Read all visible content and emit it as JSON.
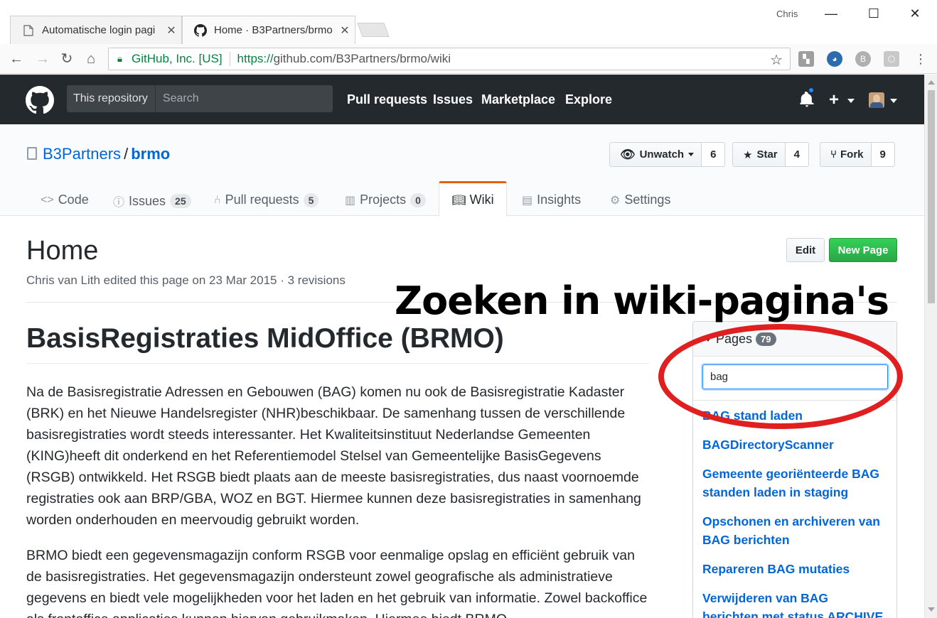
{
  "browser": {
    "user_label": "Chris",
    "tabs": [
      {
        "title": "Automatische login pagi",
        "active": false
      },
      {
        "title": "Home · B3Partners/brmo",
        "active": true
      }
    ],
    "omnibox": {
      "security_label": "GitHub, Inc. [US]",
      "url_scheme": "https://",
      "url_rest": "github.com/B3Partners/brmo/wiki"
    },
    "extension_icons": [
      "puzzle-icon",
      "globe-icon",
      "b-extension-icon",
      "box-extension-icon"
    ]
  },
  "gh_header": {
    "scope_label": "This repository",
    "search_placeholder": "Search",
    "nav": [
      "Pull requests",
      "Issues",
      "Marketplace",
      "Explore"
    ],
    "plus_label": "+"
  },
  "repo": {
    "owner": "B3Partners",
    "separator": "/",
    "name": "brmo",
    "actions": [
      {
        "label": "Unwatch",
        "count": "6"
      },
      {
        "label": "Star",
        "count": "4"
      },
      {
        "label": "Fork",
        "count": "9"
      }
    ],
    "tabs": [
      {
        "label": "Code",
        "icon": "code-icon"
      },
      {
        "label": "Issues",
        "icon": "issue-icon",
        "count": "25"
      },
      {
        "label": "Pull requests",
        "icon": "pull-request-icon",
        "count": "5"
      },
      {
        "label": "Projects",
        "icon": "project-icon",
        "count": "0"
      },
      {
        "label": "Wiki",
        "icon": "book-icon",
        "selected": true
      },
      {
        "label": "Insights",
        "icon": "graph-icon"
      },
      {
        "label": "Settings",
        "icon": "gear-icon"
      }
    ]
  },
  "wiki": {
    "page_title": "Home",
    "meta": "Chris van Lith edited this page on 23 Mar 2015 · 3 revisions",
    "edit_label": "Edit",
    "new_page_label": "New Page",
    "heading": "BasisRegistraties MidOffice (BRMO)",
    "paragraphs": [
      "Na de Basisregistratie Adressen en Gebouwen (BAG) komen nu ook de Basisregistratie Kadaster (BRK) en het Nieuwe Handelsregister (NHR)beschikbaar. De samenhang tussen de verschillende basisregistraties wordt steeds interessanter. Het Kwaliteitsinstituut Nederlandse Gemeenten (KING)heeft dit onderkend en het Referentiemodel Stelsel van Gemeentelijke BasisGegevens (RSGB) ontwikkeld. Het RSGB biedt plaats aan de meeste basisregistraties, dus naast voornoemde registraties ook aan BRP/GBA, WOZ en BGT. Hiermee kunnen deze basisregistraties in samenhang worden onderhouden en meervoudig gebruikt worden.",
      "BRMO biedt een gegevensmagazijn conform RSGB voor eenmalige opslag en efficiënt gebruik van de basisregistraties. Het gegevensmagazijn ondersteunt zowel geografische als administratieve gegevens en biedt vele mogelijkheden voor het laden en het gebruik van informatie. Zowel backoffice als frontoffice applicaties kunnen hiervan gebruikmaken. Hiermee biedt BRMO"
    ]
  },
  "overlay": {
    "caption": "Zoeken in wiki-pagina's",
    "highlight_color": "#e02020"
  },
  "sidebar": {
    "title": "Pages",
    "count": "79",
    "filter_value": "bag",
    "results": [
      "BAG stand laden",
      "BAGDirectoryScanner",
      "Gemeente georiënteerde BAG standen laden in staging",
      "Opschonen en archiveren van BAG berichten",
      "Repareren BAG mutaties",
      "Verwijderen van BAG berichten met status ARCHIVE"
    ]
  },
  "colors": {
    "gh_header_bg": "#24292e",
    "link": "#0366d6",
    "new_page_green": "#28a745",
    "wiki_tab_accent": "#e36209"
  }
}
